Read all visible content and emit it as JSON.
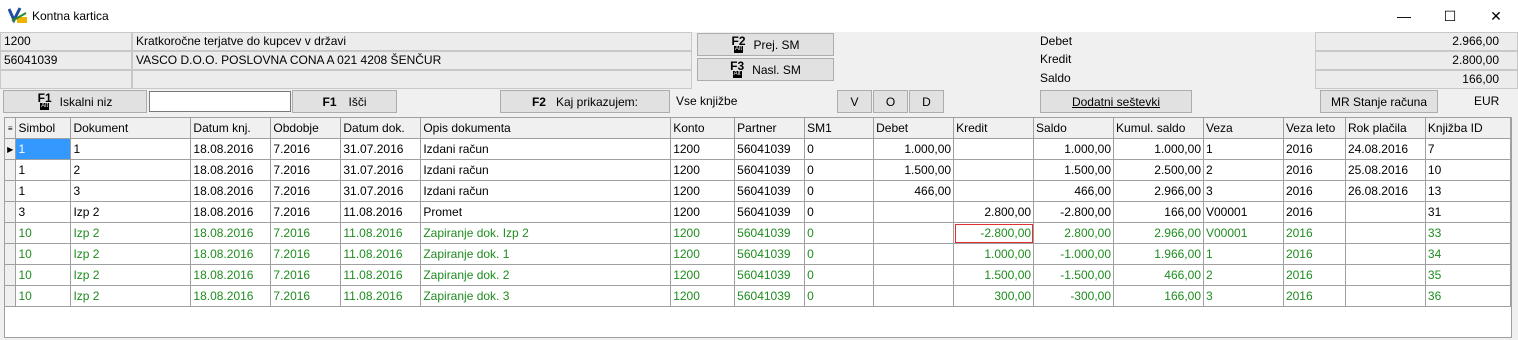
{
  "window": {
    "title": "Kontna kartica",
    "minimize": "—",
    "maximize": "☐",
    "close": "✕"
  },
  "header": {
    "account_code": "1200",
    "account_name": "Kratkoročne terjatve do kupcev v državi",
    "partner_code": "56041039",
    "partner_name": "VASCO D.O.O.  POSLOVNA CONA A 021 4208 ŠENČUR",
    "prev_btn": {
      "key": "F2",
      "mod": "Alt",
      "label": "Prej. SM"
    },
    "next_btn": {
      "key": "F3",
      "mod": "Alt",
      "label": "Nasl. SM"
    },
    "debet_label": "Debet",
    "kredit_label": "Kredit",
    "saldo_label": "Saldo",
    "debet_value": "2.966,00",
    "kredit_value": "2.800,00",
    "saldo_value": "166,00"
  },
  "toolbar": {
    "search_btn": {
      "key": "F1",
      "mod": "Alt",
      "label": "Iskalni niz"
    },
    "search_value": "",
    "find_btn": {
      "key": "F1",
      "label": "Išči"
    },
    "show_btn": {
      "key": "F2",
      "label": "Kaj prikazujem:"
    },
    "show_value": "Vse knjižbe",
    "filter_v": "V",
    "filter_o": "O",
    "filter_d": "D",
    "extra_sums": "Dodatni seštevki",
    "mr_btn": "MR Stanje računa",
    "currency": "EUR"
  },
  "table": {
    "columns": [
      "Simbol",
      "Dokument",
      "Datum knj.",
      "Obdobje",
      "Datum dok.",
      "Opis dokumenta",
      "Konto",
      "Partner",
      "SM1",
      "Debet",
      "Kredit",
      "Saldo",
      "Kumul. saldo",
      "Veza",
      "Veza leto",
      "Rok plačila",
      "Knjižba ID"
    ],
    "rows": [
      [
        "1",
        "1",
        "18.08.2016",
        "7.2016",
        "31.07.2016",
        "Izdani račun",
        "1200",
        "56041039",
        "0",
        "1.000,00",
        "",
        "1.000,00",
        "1.000,00",
        "1",
        "2016",
        "24.08.2016",
        "7"
      ],
      [
        "1",
        "2",
        "18.08.2016",
        "7.2016",
        "31.07.2016",
        "Izdani račun",
        "1200",
        "56041039",
        "0",
        "1.500,00",
        "",
        "1.500,00",
        "2.500,00",
        "2",
        "2016",
        "25.08.2016",
        "10"
      ],
      [
        "1",
        "3",
        "18.08.2016",
        "7.2016",
        "31.07.2016",
        "Izdani račun",
        "1200",
        "56041039",
        "0",
        "466,00",
        "",
        "466,00",
        "2.966,00",
        "3",
        "2016",
        "26.08.2016",
        "13"
      ],
      [
        "3",
        "Izp 2",
        "18.08.2016",
        "7.2016",
        "11.08.2016",
        "Promet",
        "1200",
        "56041039",
        "0",
        "",
        "2.800,00",
        "-2.800,00",
        "166,00",
        "V00001",
        "2016",
        "",
        "31"
      ],
      [
        "10",
        "Izp 2",
        "18.08.2016",
        "7.2016",
        "11.08.2016",
        "Zapiranje dok. Izp 2",
        "1200",
        "56041039",
        "0",
        "",
        "-2.800,00",
        "2.800,00",
        "2.966,00",
        "V00001",
        "2016",
        "",
        "33"
      ],
      [
        "10",
        "Izp 2",
        "18.08.2016",
        "7.2016",
        "11.08.2016",
        "Zapiranje dok. 1",
        "1200",
        "56041039",
        "0",
        "",
        "1.000,00",
        "-1.000,00",
        "1.966,00",
        "1",
        "2016",
        "",
        "34"
      ],
      [
        "10",
        "Izp 2",
        "18.08.2016",
        "7.2016",
        "11.08.2016",
        "Zapiranje dok. 2",
        "1200",
        "56041039",
        "0",
        "",
        "1.500,00",
        "-1.500,00",
        "466,00",
        "2",
        "2016",
        "",
        "35"
      ],
      [
        "10",
        "Izp 2",
        "18.08.2016",
        "7.2016",
        "11.08.2016",
        "Zapiranje dok. 3",
        "1200",
        "56041039",
        "0",
        "",
        "300,00",
        "-300,00",
        "166,00",
        "3",
        "2016",
        "",
        "36"
      ]
    ],
    "green_rows": [
      4,
      5,
      6,
      7
    ],
    "colors": {
      "green_text": "#1e8c1e",
      "selection": "#3399ff",
      "error_border": "#e03030"
    }
  }
}
